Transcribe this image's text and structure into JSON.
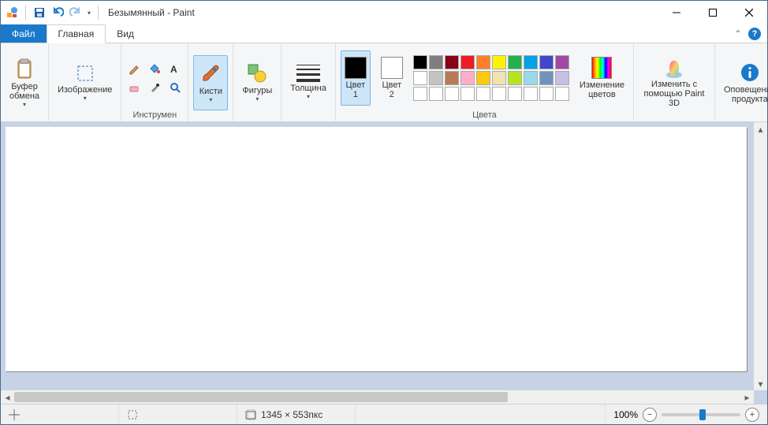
{
  "titlebar": {
    "title": "Безымянный - Paint"
  },
  "tabs": {
    "file": "Файл",
    "home": "Главная",
    "view": "Вид"
  },
  "ribbon": {
    "clipboard": {
      "label": "Буфер\nобмена",
      "group": ""
    },
    "image": {
      "label": "Изображение",
      "group": ""
    },
    "tools": {
      "group": "Инструмен"
    },
    "brushes": {
      "label": "Кисти"
    },
    "shapes": {
      "label": "Фигуры"
    },
    "size": {
      "label": "Толщина"
    },
    "color1": {
      "label": "Цвет\n1"
    },
    "color2": {
      "label": "Цвет\n2"
    },
    "edit_colors": {
      "label": "Изменение\nцветов"
    },
    "colors_group": "Цвета",
    "paint3d": {
      "label": "Изменить с\nпомощью Paint 3D"
    },
    "alert": {
      "label": "Оповещение\nпродукта"
    }
  },
  "palette": {
    "row1": [
      "#000000",
      "#7f7f7f",
      "#880015",
      "#ed1c24",
      "#ff7f27",
      "#fff200",
      "#22b14c",
      "#00a2e8",
      "#3f48cc",
      "#a349a4"
    ],
    "row2": [
      "#ffffff",
      "#c3c3c3",
      "#b97a57",
      "#ffaec9",
      "#ffc90e",
      "#efe4b0",
      "#b5e61d",
      "#99d9ea",
      "#7092be",
      "#c8bfe7"
    ],
    "row3_empty": 10
  },
  "status": {
    "dimensions": "1345 × 553пкс",
    "zoom": "100%"
  }
}
